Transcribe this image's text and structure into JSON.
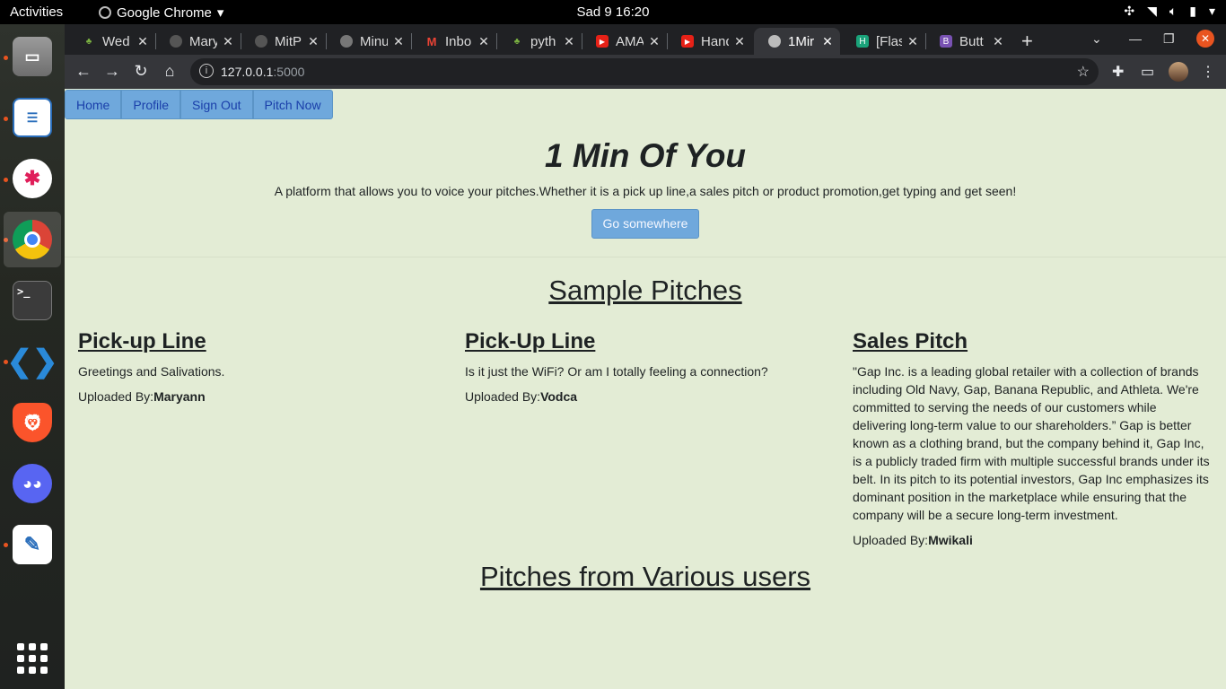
{
  "system": {
    "activities": "Activities",
    "app_name": "Google Chrome",
    "clock": "Sad 9  16:20"
  },
  "dock": {
    "items": [
      "Files",
      "LibreOffice Writer",
      "Slack",
      "Google Chrome",
      "Terminal",
      "Visual Studio Code",
      "Brave",
      "Discord",
      "Text Editor",
      "Show Applications"
    ]
  },
  "browser": {
    "tabs": [
      {
        "title": "Wed",
        "icon": "palm-icon"
      },
      {
        "title": "Mary",
        "icon": "github-icon"
      },
      {
        "title": "MitP",
        "icon": "github-icon"
      },
      {
        "title": "Minu",
        "icon": "globe-icon"
      },
      {
        "title": "Inbo",
        "icon": "gmail-icon"
      },
      {
        "title": "pyth",
        "icon": "palm-icon"
      },
      {
        "title": "AMA",
        "icon": "youtube-icon"
      },
      {
        "title": "Hand",
        "icon": "youtube-icon"
      },
      {
        "title": "1Mir",
        "icon": "globe-icon",
        "active": true
      },
      {
        "title": "[Flas",
        "icon": "hackmd-icon"
      },
      {
        "title": "Butt",
        "icon": "bootstrap-icon"
      }
    ],
    "url_host": "127.0.0.1",
    "url_port": ":5000"
  },
  "page": {
    "nav": [
      "Home",
      "Profile",
      "Sign Out",
      "Pitch Now"
    ],
    "hero": {
      "title": "1 Min Of You",
      "tagline": "A platform that allows you to voice your pitches.Whether it is a pick up line,a sales pitch or product promotion,get typing and get seen!",
      "button": "Go somewhere"
    },
    "sample_heading": "Sample Pitches",
    "pitches": [
      {
        "title": "Pick-up Line",
        "body": "Greetings and Salivations.",
        "by_label": "Uploaded By:",
        "author": "Maryann"
      },
      {
        "title": "Pick-Up Line",
        "body": "Is it just the WiFi? Or am I totally feeling a connection?",
        "by_label": "Uploaded By:",
        "author": "Vodca"
      },
      {
        "title": "Sales Pitch",
        "body": "\"Gap Inc. is a leading global retailer with a collection of brands including Old Navy, Gap, Banana Republic, and Athleta. We're committed to serving the needs of our customers while delivering long-term value to our shareholders.” Gap is better known as a clothing brand, but the company behind it, Gap Inc, is a publicly traded firm with multiple successful brands under its belt. In its pitch to its potential investors, Gap Inc emphasizes its dominant position in the marketplace while ensuring that the company will be a secure long-term investment.",
        "by_label": "Uploaded By:",
        "author": "Mwikali"
      }
    ],
    "users_heading": "Pitches from Various users"
  },
  "colors": {
    "page_bg": "#e3ecd5",
    "button_bg": "#6fa8dc",
    "link": "#1a3faa"
  }
}
